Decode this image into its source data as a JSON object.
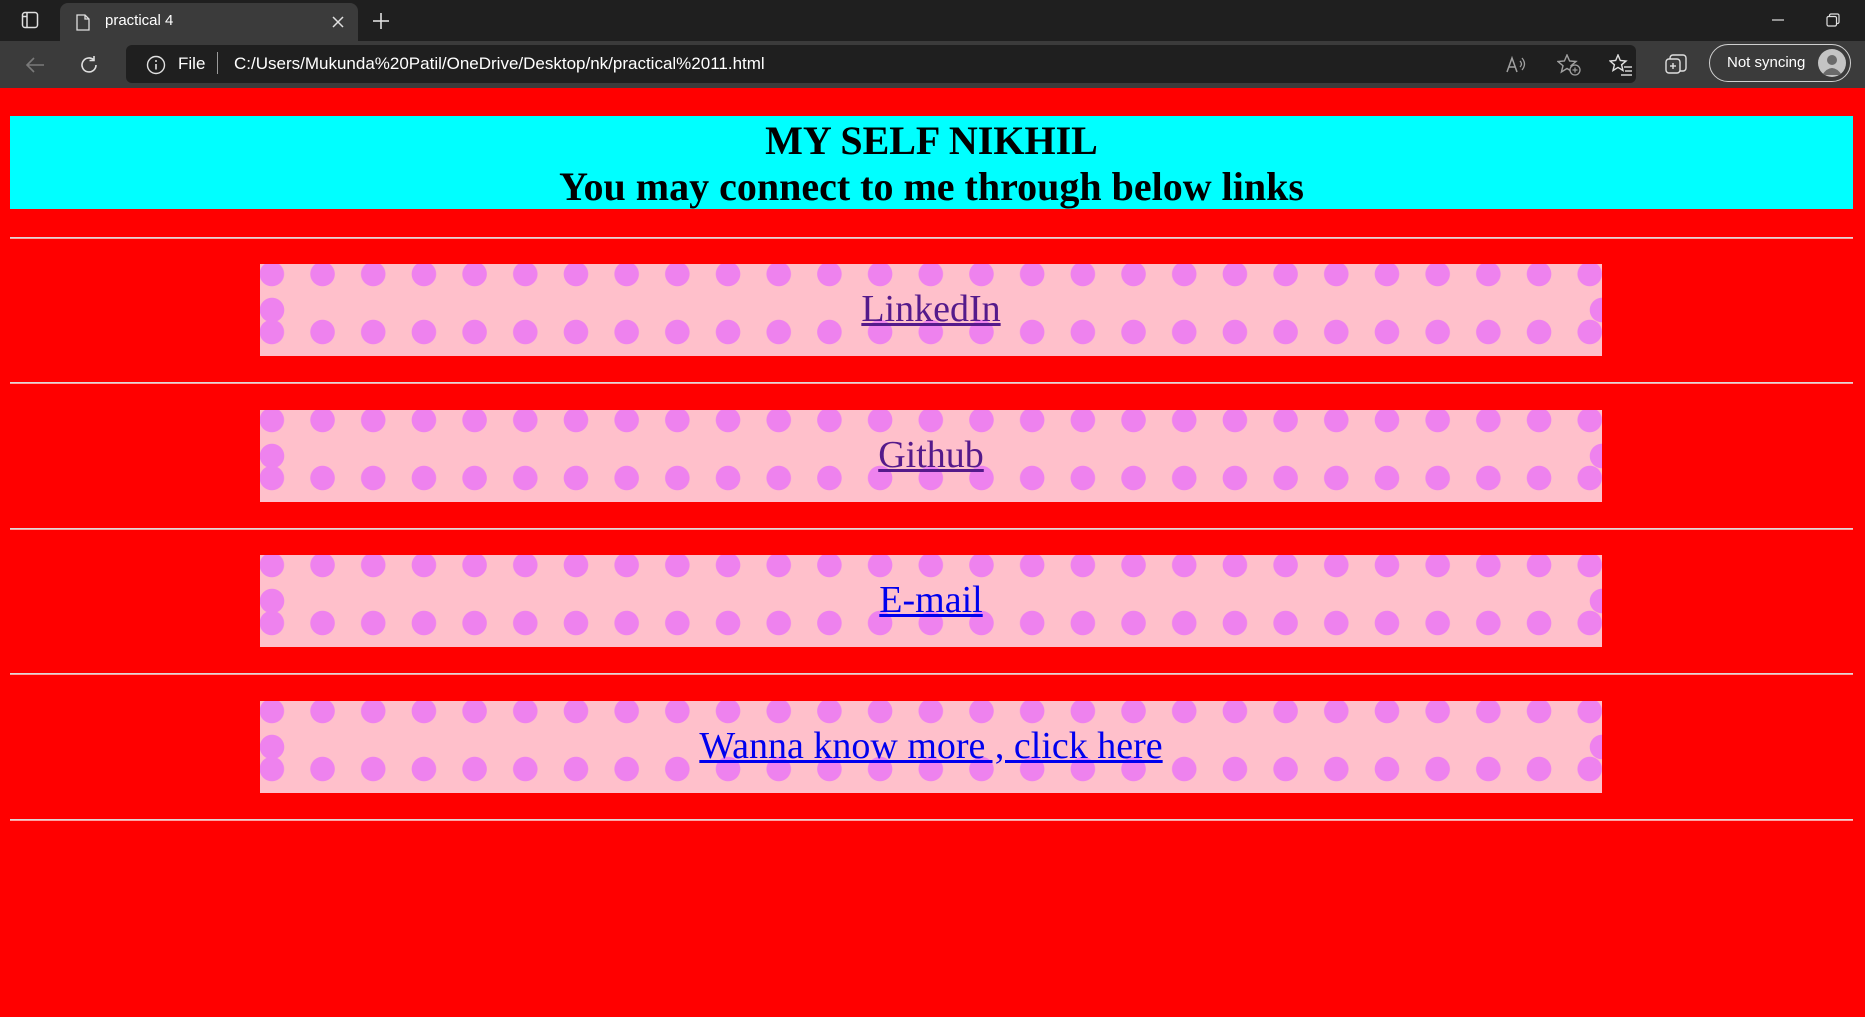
{
  "browser": {
    "tab_title": "practical 4",
    "address_prefix": "File",
    "url": "C:/Users/Mukunda%20Patil/OneDrive/Desktop/nk/practical%2011.html",
    "profile_label": "Not syncing",
    "icons": {
      "tab_actions": "tab-actions-icon",
      "page": "page-icon",
      "close": "close-icon",
      "new_tab": "plus-icon",
      "back": "back-arrow-icon",
      "refresh": "refresh-icon",
      "info": "info-icon",
      "read_aloud": "read-aloud-icon",
      "add_favorite": "add-favorite-icon",
      "favorites": "favorites-icon",
      "collections": "collections-icon"
    }
  },
  "page": {
    "background_color": "#ff0000",
    "header": {
      "line1": "MY SELF NIKHIL",
      "line2": "You may connect to me through below links",
      "background_color": "#00ffff"
    },
    "links": [
      {
        "label": "LinkedIn",
        "state": "visited"
      },
      {
        "label": "Github",
        "state": "visited"
      },
      {
        "label": "E-mail",
        "state": "unvisited"
      },
      {
        "label": "Wanna know more , click here",
        "state": "unvisited"
      }
    ],
    "colors": {
      "box_background": "#ffc0cb",
      "dot_color": "#ee82ee",
      "visited_link": "#551a8b",
      "unvisited_link": "#0000ee"
    }
  }
}
